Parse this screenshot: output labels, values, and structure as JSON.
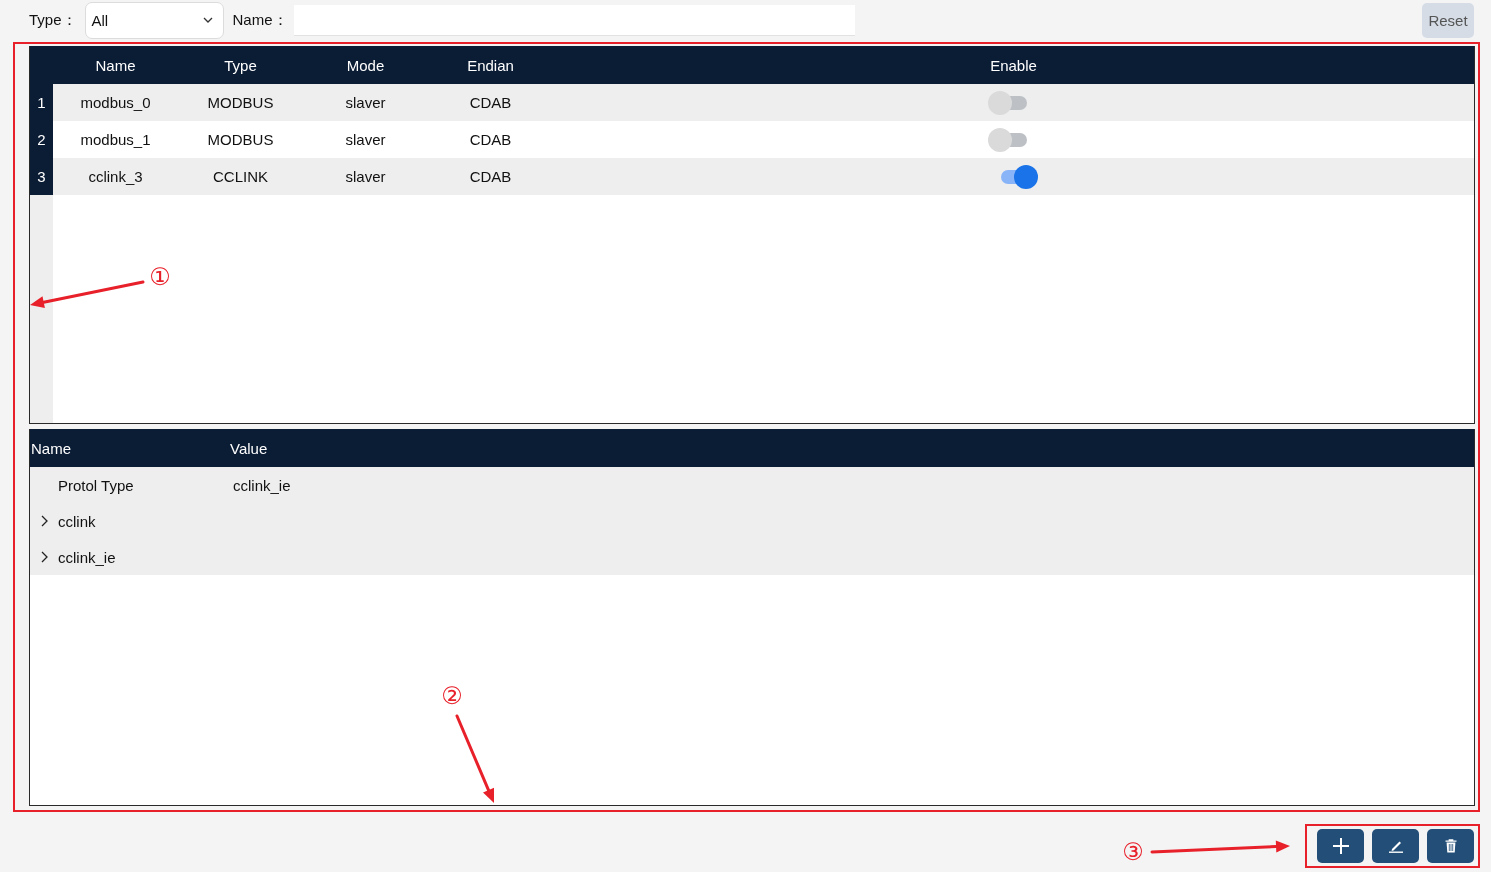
{
  "filter_bar": {
    "type_label": "Type：",
    "type_select": {
      "value": "All"
    },
    "name_label": "Name：",
    "reset_button": "Reset"
  },
  "device_table": {
    "columns": [
      "Name",
      "Type",
      "Mode",
      "Endian",
      "Enable"
    ],
    "rows": [
      {
        "index": "1",
        "name": "modbus_0",
        "type": "MODBUS",
        "mode": "slaver",
        "endian": "CDAB",
        "enabled": false
      },
      {
        "index": "2",
        "name": "modbus_1",
        "type": "MODBUS",
        "mode": "slaver",
        "endian": "CDAB",
        "enabled": false
      },
      {
        "index": "3",
        "name": "cclink_3",
        "type": "CCLINK",
        "mode": "slaver",
        "endian": "CDAB",
        "enabled": true
      }
    ]
  },
  "property_grid": {
    "columns": [
      "Name",
      "Value"
    ],
    "rows": [
      {
        "kind": "property",
        "name": "Protol Type",
        "value": "cclink_ie"
      },
      {
        "kind": "group",
        "name": "cclink",
        "expanded": false
      },
      {
        "kind": "group",
        "name": "cclink_ie",
        "expanded": false
      }
    ]
  },
  "annotations": [
    {
      "label": "①"
    },
    {
      "label": "②"
    },
    {
      "label": "③"
    }
  ]
}
